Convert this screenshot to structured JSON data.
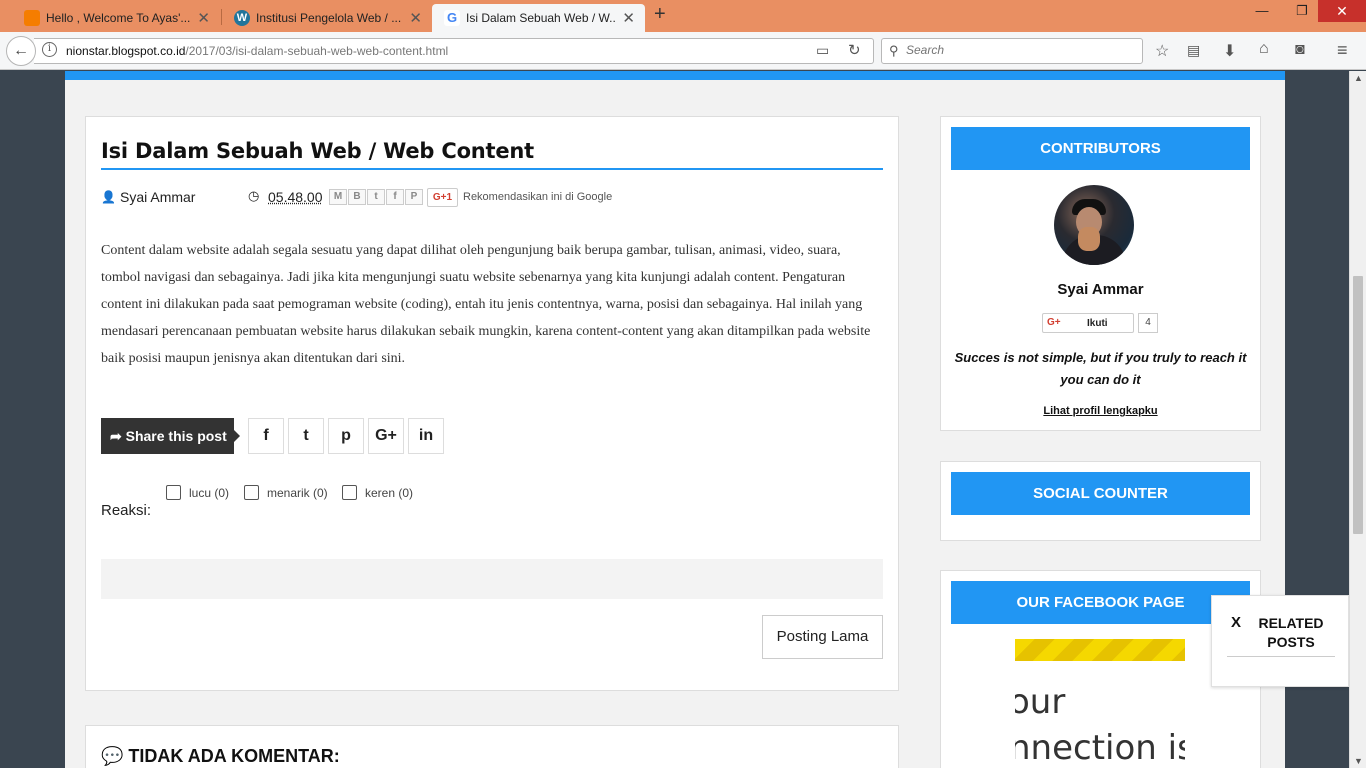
{
  "browser": {
    "tabs": [
      {
        "title": "Hello , Welcome To Ayas'...",
        "icon": "blogger-icon",
        "color": "#f57d00"
      },
      {
        "title": "Institusi Pengelola Web / ...",
        "icon": "wordpress-icon",
        "color": "#21759b"
      },
      {
        "title": "Isi Dalam Sebuah Web / W...",
        "icon": "google-icon",
        "color": "#4285f4"
      }
    ],
    "url_host": "nionstar.blogspot.co.id",
    "url_path": "/2017/03/isi-dalam-sebuah-web-web-content.html",
    "search_placeholder": "Search"
  },
  "colors": {
    "accent": "#2196f3",
    "tabbar": "#e98f62"
  },
  "post": {
    "title": "Isi Dalam Sebuah Web / Web Content",
    "author": "Syai Ammar",
    "time": "05.48.00",
    "gplus_label": "G+1",
    "gplus_text": "Rekomendasikan ini di Google",
    "body": "Content dalam website adalah segala sesuatu yang dapat dilihat oleh pengunjung baik berupa gambar, tulisan, animasi, video, suara, tombol navigasi dan sebagainya. Jadi jika kita mengunjungi suatu website sebenarnya yang kita kunjungi adalah content. Pengaturan content ini dilakukan pada saat pemograman website (coding), entah itu jenis contentnya, warna, posisi dan sebagainya. Hal inilah yang mendasari perencanaan pembuatan website harus dilakukan sebaik mungkin, karena content-content yang akan ditampilkan pada website baik posisi maupun jenisnya akan ditentukan dari sini.",
    "share_label": "Share this post",
    "share_buttons": [
      "f",
      "t",
      "p",
      "G+",
      "in"
    ],
    "reactions_label": "Reaksi:",
    "reactions": [
      "lucu (0)",
      "menarik (0)",
      "keren (0)"
    ],
    "older_label": "Posting Lama"
  },
  "comments": {
    "title": "TIDAK ADA KOMENTAR:"
  },
  "sidebar": {
    "contributors": {
      "heading": "CONTRIBUTORS",
      "name": "Syai Ammar",
      "follow_label": "Ikuti",
      "follow_g": "G+",
      "follow_count": "4",
      "quote": "Succes is not simple, but if you truly to reach it you can do it",
      "profile_link": "Lihat profil lengkapku"
    },
    "social": {
      "heading": "SOCIAL COUNTER"
    },
    "facebook": {
      "heading": "OUR FACEBOOK PAGE",
      "image_text": "our\nnnection is"
    }
  },
  "related": {
    "close": "X",
    "title": "RELATED POSTS"
  }
}
